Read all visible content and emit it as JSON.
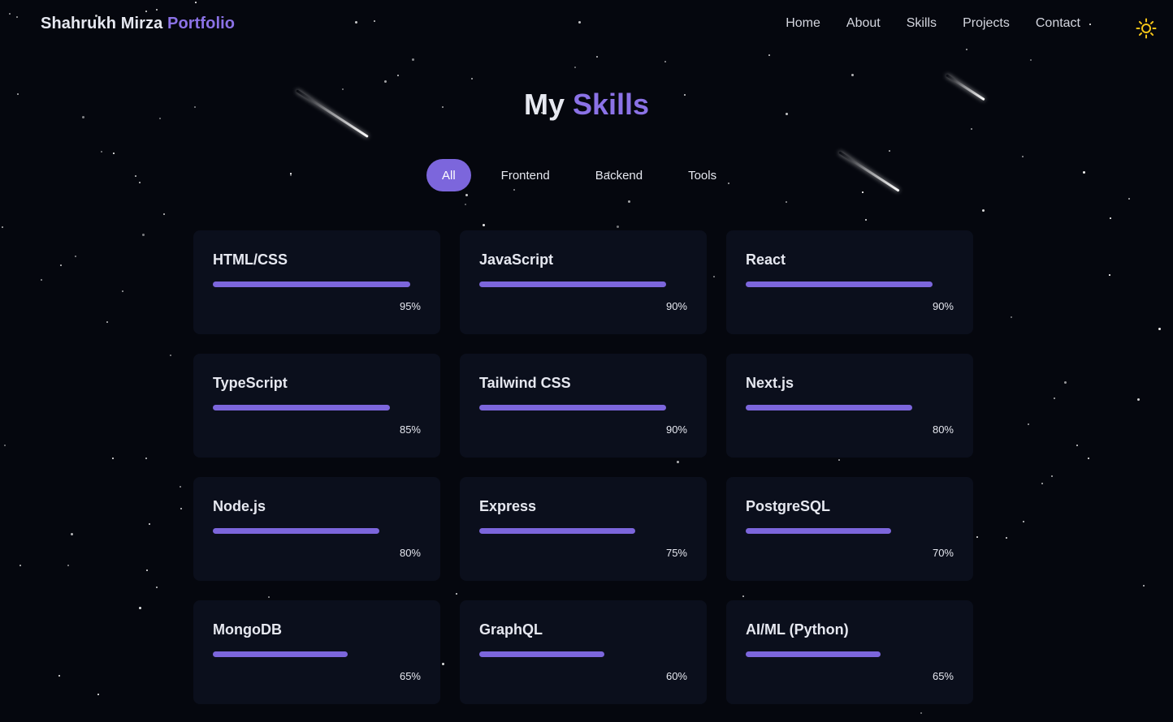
{
  "navbar": {
    "brand_name": "Shahrukh Mirza",
    "brand_accent": "Portfolio",
    "links": [
      "Home",
      "About",
      "Skills",
      "Projects",
      "Contact"
    ],
    "theme_icon": "sun-icon"
  },
  "section": {
    "title_main": "My",
    "title_accent": "Skills"
  },
  "filters": {
    "options": [
      "All",
      "Frontend",
      "Backend",
      "Tools"
    ],
    "selected": "All"
  },
  "skills": [
    {
      "name": "HTML/CSS",
      "percent_label": "95%",
      "level": 0.95
    },
    {
      "name": "JavaScript",
      "percent_label": "90%",
      "level": 0.9
    },
    {
      "name": "React",
      "percent_label": "90%",
      "level": 0.9
    },
    {
      "name": "TypeScript",
      "percent_label": "85%",
      "level": 0.85
    },
    {
      "name": "Tailwind CSS",
      "percent_label": "90%",
      "level": 0.9
    },
    {
      "name": "Next.js",
      "percent_label": "80%",
      "level": 0.8
    },
    {
      "name": "Node.js",
      "percent_label": "80%",
      "level": 0.8
    },
    {
      "name": "Express",
      "percent_label": "75%",
      "level": 0.75
    },
    {
      "name": "PostgreSQL",
      "percent_label": "70%",
      "level": 0.7
    },
    {
      "name": "MongoDB",
      "percent_label": "65%",
      "level": 0.65
    },
    {
      "name": "GraphQL",
      "percent_label": "60%",
      "level": 0.6
    },
    {
      "name": "AI/ML (Python)",
      "percent_label": "65%",
      "level": 0.65
    }
  ],
  "colors": {
    "accent": "#7c66dc",
    "background": "#05070e",
    "card": "#0b0f1c",
    "theme_icon": "#f5c518"
  }
}
